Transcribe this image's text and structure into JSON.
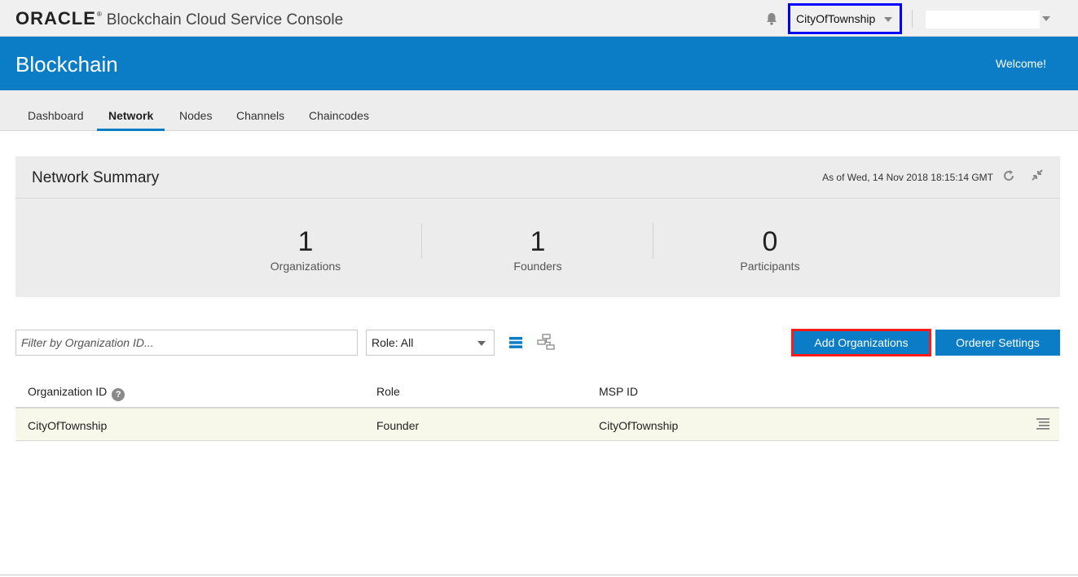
{
  "header": {
    "logo_brand": "ORACLE",
    "logo_product": "Blockchain Cloud Service Console",
    "org_selector_value": "CityOfTownship",
    "user_selector_value": ""
  },
  "banner": {
    "title": "Blockchain",
    "welcome": "Welcome!"
  },
  "tabs": [
    {
      "label": "Dashboard",
      "active": false
    },
    {
      "label": "Network",
      "active": true
    },
    {
      "label": "Nodes",
      "active": false
    },
    {
      "label": "Channels",
      "active": false
    },
    {
      "label": "Chaincodes",
      "active": false
    }
  ],
  "summary": {
    "title": "Network Summary",
    "as_of": "As of Wed, 14 Nov 2018 18:15:14 GMT",
    "metrics": [
      {
        "value": "1",
        "label": "Organizations"
      },
      {
        "value": "1",
        "label": "Founders"
      },
      {
        "value": "0",
        "label": "Participants"
      }
    ]
  },
  "toolbar": {
    "filter_placeholder": "Filter by Organization ID...",
    "role_select_value": "Role: All",
    "add_button": "Add Organizations",
    "orderer_button": "Orderer Settings"
  },
  "table": {
    "columns": [
      "Organization ID",
      "Role",
      "MSP ID"
    ],
    "rows": [
      {
        "org_id": "CityOfTownship",
        "role": "Founder",
        "msp_id": "CityOfTownship"
      }
    ]
  },
  "colors": {
    "brand_blue": "#0a7dc6",
    "highlight_org_selector": "#0000ff",
    "highlight_add_button": "#ff1a1a",
    "row_background": "#f7f8ea"
  }
}
